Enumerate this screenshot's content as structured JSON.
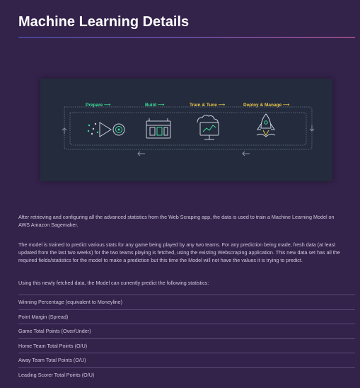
{
  "page": {
    "title": "Machine Learning Details"
  },
  "figure": {
    "stages": [
      {
        "label": "Prepare ⟶",
        "icon": "prepare-icon",
        "color": "#3ddc97"
      },
      {
        "label": "Build ⟶",
        "icon": "build-icon",
        "color": "#3ddc97"
      },
      {
        "label": "Train & Tune ⟶",
        "icon": "train-tune-icon",
        "color": "#e6c34a"
      },
      {
        "label": "Deploy & Manage ⟶",
        "icon": "deploy-manage-icon",
        "color": "#e6c34a"
      }
    ],
    "line_color": "#6e7a8c",
    "icon_color": "#c9d2dc",
    "accent_color": "#3ddc97"
  },
  "content": {
    "paragraph1": "After retrieving and configuring all the advanced statistics from the Web Scraping app, the data is used to train a Machine Learning Model on AWS Amazon Sagemaker.",
    "paragraph2": "The model is trained to predict various stats for any game being played by any two teams. For any prediction being made, fresh data (at least updated from the last two weeks) for the two teams playing is fetched, using the existing Webscraping application. This new data set has all the required fields/statistics for the model to make a prediction but this time the Model will not have the values it is trying to predict.",
    "paragraph3": "Using this newly fetched data, the Model can currently predict the following statistics:",
    "stats": [
      "Winning Percentage (equivalent to Moneyline)",
      "Point Margin (Spread)",
      "Game Total Points (Over/Under)",
      "Home Team Total Points (O/U)",
      "Away Team Total Points (O/U)",
      "Leading Scorer Total Points (O/U)"
    ]
  },
  "colors": {
    "background": "#33224a",
    "figure_background": "#232b3c",
    "divider": "#5b4c78"
  }
}
